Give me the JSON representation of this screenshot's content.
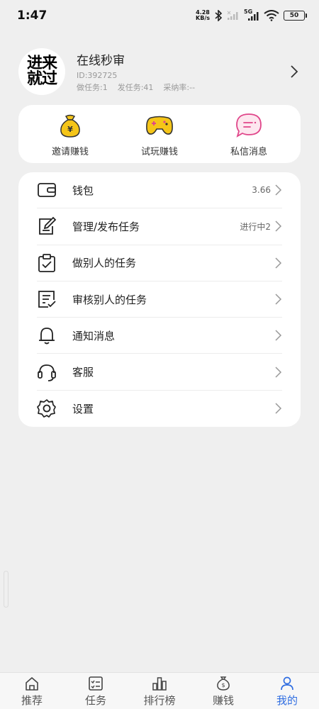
{
  "status_bar": {
    "time": "1:47",
    "net_speed_value": "4.28",
    "net_speed_unit": "KB/s",
    "network": "5G",
    "battery": "50"
  },
  "profile": {
    "avatar_text": "进来就过",
    "name": "在线秒审",
    "id": "ID:392725",
    "tasks_done": "做任务:1",
    "tasks_posted": "发任务:41",
    "accept_rate": "采纳率:--"
  },
  "quick_actions": [
    {
      "label": "邀请赚钱",
      "icon": "money-bag-icon"
    },
    {
      "label": "试玩赚钱",
      "icon": "gamepad-icon"
    },
    {
      "label": "私信消息",
      "icon": "chat-bubble-icon"
    }
  ],
  "menu": [
    {
      "label": "钱包",
      "value": "3.66",
      "icon": "wallet-icon"
    },
    {
      "label": "管理/发布任务",
      "value": "进行中2",
      "icon": "edit-icon"
    },
    {
      "label": "做别人的任务",
      "value": "",
      "icon": "clipboard-check-icon"
    },
    {
      "label": "审核别人的任务",
      "value": "",
      "icon": "review-list-icon"
    },
    {
      "label": "通知消息",
      "value": "",
      "icon": "bell-icon"
    },
    {
      "label": "客服",
      "value": "",
      "icon": "headset-icon"
    },
    {
      "label": "设置",
      "value": "",
      "icon": "gear-icon"
    }
  ],
  "bottom_nav": [
    {
      "label": "推荐",
      "icon": "home-icon",
      "active": false
    },
    {
      "label": "任务",
      "icon": "task-list-icon",
      "active": false
    },
    {
      "label": "排行榜",
      "icon": "ranking-icon",
      "active": false
    },
    {
      "label": "赚钱",
      "icon": "earn-money-icon",
      "active": false
    },
    {
      "label": "我的",
      "icon": "user-icon",
      "active": true
    }
  ],
  "colors": {
    "accent": "#2f6de1",
    "page_bg": "#efefef",
    "card_bg": "#ffffff",
    "gold": "#f5c518",
    "pink": "#e0468a"
  }
}
